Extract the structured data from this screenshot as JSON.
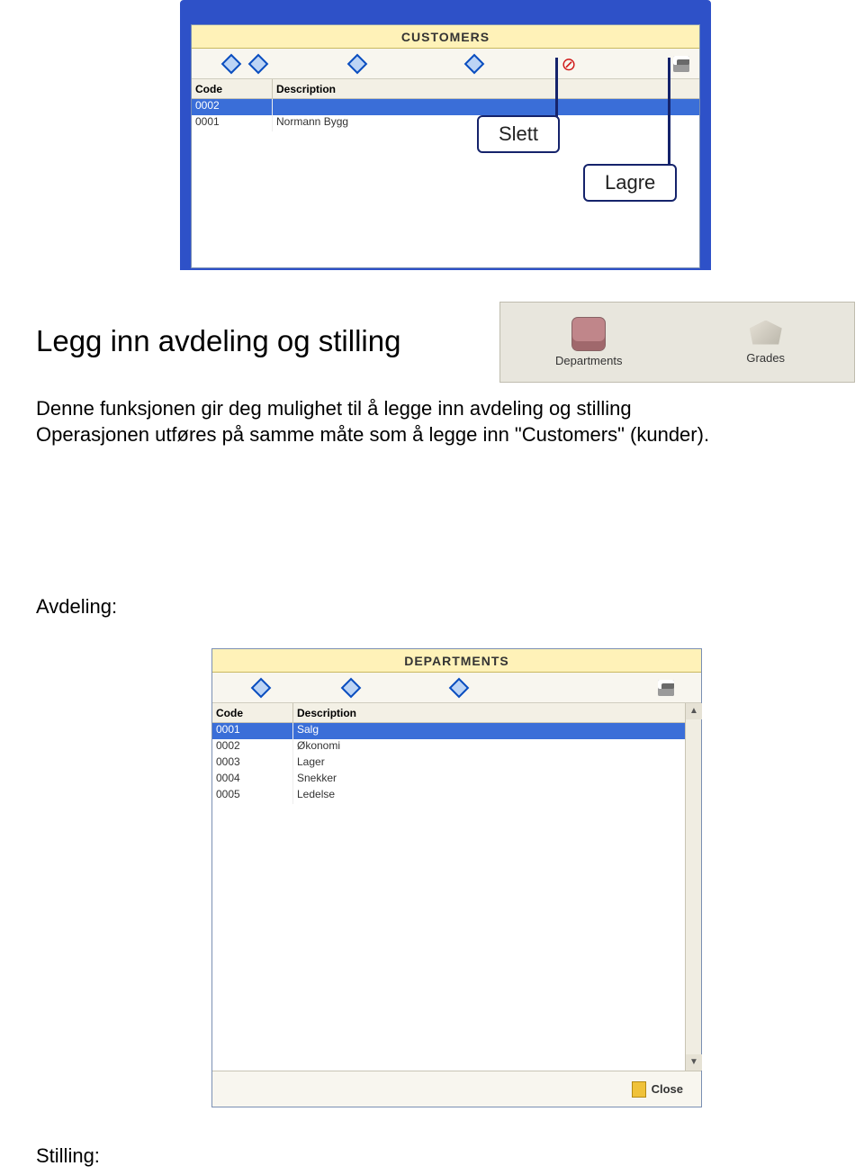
{
  "customers_window": {
    "title": "CUSTOMERS",
    "columns": {
      "code": "Code",
      "description": "Description"
    },
    "rows": [
      {
        "code": "0002",
        "description": ""
      },
      {
        "code": "0001",
        "description": "Normann Bygg"
      }
    ]
  },
  "callouts": {
    "delete": "Slett",
    "save": "Lagre"
  },
  "quickbuttons": {
    "departments": "Departments",
    "grades": "Grades"
  },
  "text": {
    "heading": "Legg inn avdeling og stilling",
    "para": "Denne funksjonen gir deg mulighet til å legge inn avdeling og stilling\nOperasjonen utføres på samme måte som å legge inn \"Customers\" (kunder).",
    "avdeling_label": "Avdeling:",
    "stilling_label": "Stilling:"
  },
  "departments_window": {
    "title": "DEPARTMENTS",
    "columns": {
      "code": "Code",
      "description": "Description"
    },
    "rows": [
      {
        "code": "0001",
        "description": "Salg"
      },
      {
        "code": "0002",
        "description": "Økonomi"
      },
      {
        "code": "0003",
        "description": "Lager"
      },
      {
        "code": "0004",
        "description": "Snekker"
      },
      {
        "code": "0005",
        "description": "Ledelse"
      }
    ],
    "close": "Close"
  }
}
